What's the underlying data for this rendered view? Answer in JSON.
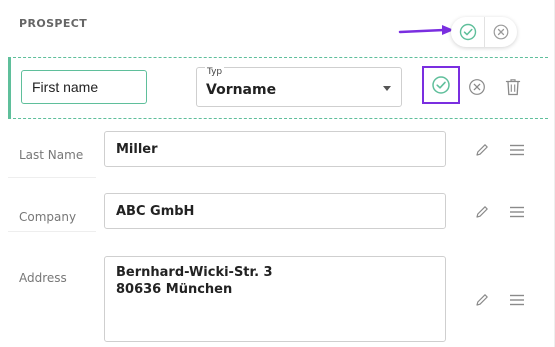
{
  "section": {
    "title": "PROSPECT"
  },
  "header_actions": {
    "confirm_icon": "check-circle-icon",
    "cancel_icon": "close-circle-icon"
  },
  "edit_row": {
    "first_name_value": "First name",
    "type_label": "Typ",
    "type_value": "Vorname",
    "confirm_icon": "check-circle-icon",
    "cancel_icon": "close-circle-icon",
    "delete_icon": "trash-icon"
  },
  "fields": [
    {
      "label": "Last Name",
      "value": "Miller"
    },
    {
      "label": "Company",
      "value": "ABC GmbH"
    },
    {
      "label": "Address",
      "lines": [
        "Bernhard-Wicki-Str. 3",
        "80636 München"
      ]
    }
  ],
  "colors": {
    "accent": "#5fbf9b",
    "highlight": "#7a2ee0",
    "icon_gray": "#8a8a8a"
  }
}
